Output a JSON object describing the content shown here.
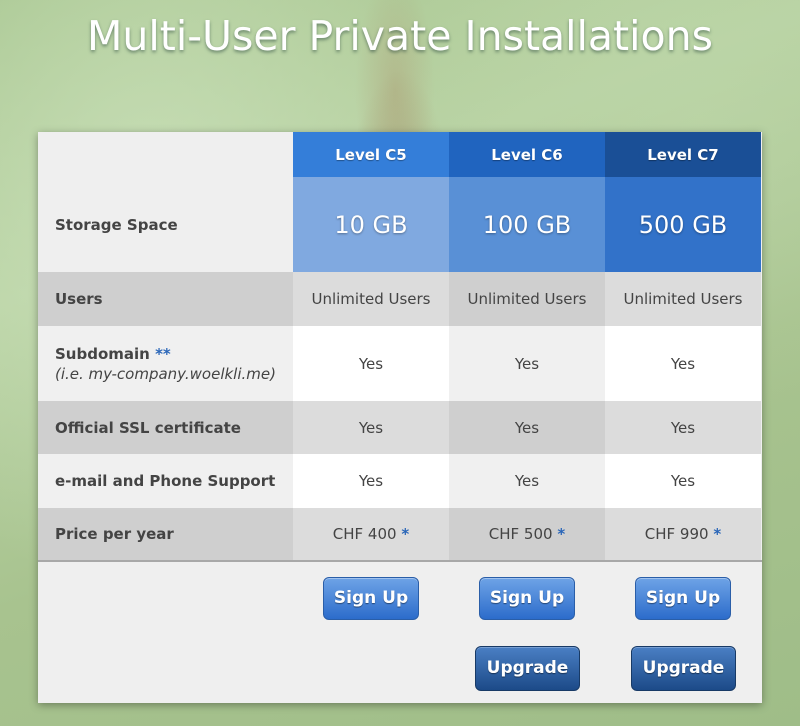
{
  "page": {
    "title": "Multi-User Private Installations"
  },
  "plans": [
    {
      "name": "Level C5",
      "storage": "10 GB",
      "users": "Unlimited Users",
      "subdomain": "Yes",
      "ssl": "Yes",
      "support": "Yes",
      "price": "CHF 400",
      "price_mark": "*",
      "signup_label": "Sign Up"
    },
    {
      "name": "Level C6",
      "storage": "100 GB",
      "users": "Unlimited Users",
      "subdomain": "Yes",
      "ssl": "Yes",
      "support": "Yes",
      "price": "CHF 500",
      "price_mark": "*",
      "signup_label": "Sign Up",
      "upgrade_label": "Upgrade"
    },
    {
      "name": "Level C7",
      "storage": "500 GB",
      "users": "Unlimited Users",
      "subdomain": "Yes",
      "ssl": "Yes",
      "support": "Yes",
      "price": "CHF 990",
      "price_mark": "*",
      "signup_label": "Sign Up",
      "upgrade_label": "Upgrade"
    }
  ],
  "features": {
    "storage": "Storage Space",
    "users": "Users",
    "subdomain": "Subdomain",
    "subdomain_mark": "**",
    "subdomain_note": "(i.e. my-company.woelkli.me)",
    "ssl": "Official SSL certificate",
    "support": "e-mail and Phone Support",
    "price": "Price per year"
  },
  "colors": {
    "header_c5": "#347ed9",
    "header_c6": "#2064bf",
    "header_c7": "#1a4f96",
    "accent_star": "#2a66b8"
  }
}
